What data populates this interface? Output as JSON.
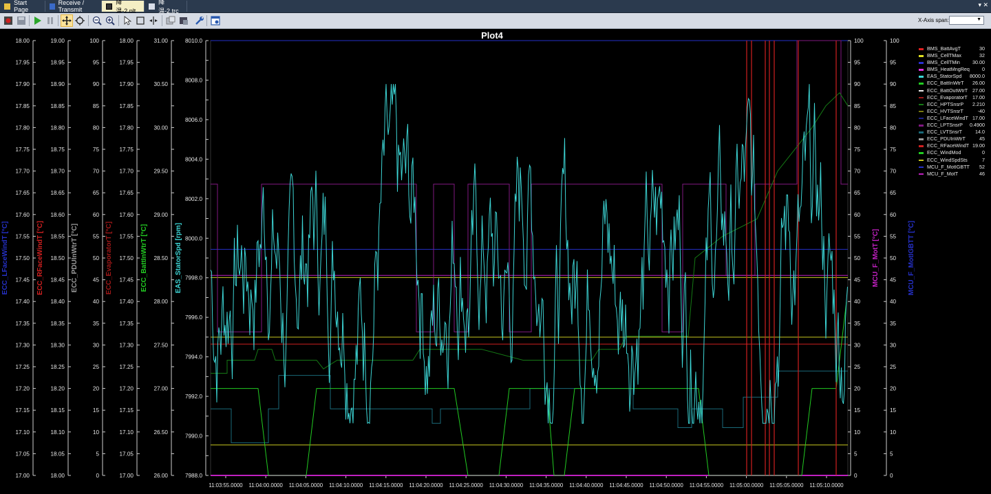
{
  "tabs": [
    {
      "label": "Start Page",
      "icon": "start-page-icon",
      "active": false
    },
    {
      "label": "Receive / Transmit",
      "icon": "receive-transmit-icon",
      "active": false
    },
    {
      "label": "降温-2.plt",
      "icon": "plot-file-icon",
      "active": true
    },
    {
      "label": "降温-2.trc",
      "icon": "trace-file-icon",
      "active": false
    }
  ],
  "toolbar": {
    "xspan_label": "X-Axis span:",
    "xspan_value": "",
    "buttons": [
      "record-icon",
      "save-icon",
      "play-icon",
      "pause-icon",
      "pan-icon",
      "zoom-fit-icon",
      "zoom-out-icon",
      "zoom-in-icon",
      "select-icon",
      "zoom-box-icon",
      "cursor-icon",
      "export-icon",
      "export-image-icon",
      "settings-icon",
      "layout-icon"
    ]
  },
  "colors": {
    "tabbar": "#2b3a4e",
    "toolbar": "#d6dbe4",
    "plot_bg": "#000000",
    "grid": "#1a1a1a",
    "stator": "#3dd6d6"
  },
  "plot": {
    "title": "Plot4",
    "left_axes": [
      {
        "name": "ECC_LFaceWindT [°C]",
        "color": "#2530c8",
        "ticks": [
          "18.00",
          "17.95",
          "17.90",
          "17.85",
          "17.80",
          "17.75",
          "17.70",
          "17.65",
          "17.60",
          "17.55",
          "17.50",
          "17.45",
          "17.40",
          "17.35",
          "17.30",
          "17.25",
          "17.20",
          "17.15",
          "17.10",
          "17.05",
          "17.00"
        ]
      },
      {
        "name": "ECC_RFaceWindT [°C]",
        "color": "#d02020",
        "ticks": [
          "19.00",
          "18.95",
          "18.90",
          "18.85",
          "18.80",
          "18.75",
          "18.70",
          "18.65",
          "18.60",
          "18.55",
          "18.50",
          "18.45",
          "18.40",
          "18.35",
          "18.30",
          "18.25",
          "18.20",
          "18.15",
          "18.10",
          "18.05",
          "18.00"
        ]
      },
      {
        "name": "ECC_PDUInWtrT [°C]",
        "color": "#9a9a9a",
        "ticks": [
          "100",
          "95",
          "90",
          "85",
          "80",
          "75",
          "70",
          "65",
          "60",
          "55",
          "50",
          "45",
          "40",
          "35",
          "30",
          "25",
          "20",
          "15",
          "10",
          "5",
          "0"
        ]
      },
      {
        "name": "ECC_EvaporatorT [°C]",
        "color": "#a01818",
        "ticks": [
          "18.00",
          "17.95",
          "17.90",
          "17.85",
          "17.80",
          "17.75",
          "17.70",
          "17.65",
          "17.60",
          "17.55",
          "17.50",
          "17.45",
          "17.40",
          "17.35",
          "17.30",
          "17.25",
          "17.20",
          "17.15",
          "17.10",
          "17.05",
          "17.00"
        ]
      },
      {
        "name": "ECC_BattInWtrT [°C]",
        "color": "#22cc22",
        "ticks": [
          "31.00",
          "",
          "30.50",
          "",
          "30.00",
          "",
          "29.50",
          "",
          "29.00",
          "",
          "28.50",
          "",
          "28.00",
          "",
          "27.50",
          "",
          "27.00",
          "",
          "26.50",
          "",
          "26.00"
        ]
      },
      {
        "name": "EAS_StatorSpd [rpm]",
        "color": "#3dd6d6",
        "ticks": [
          "8010.0",
          "",
          "8008.0",
          "",
          "8006.0",
          "",
          "8004.0",
          "",
          "8002.0",
          "",
          "8000.0",
          "",
          "7998.0",
          "",
          "7996.0",
          "",
          "7994.0",
          "",
          "7992.0",
          "",
          "7990.0",
          "",
          "7988.0"
        ]
      }
    ],
    "right_axes": [
      {
        "name": "MCU_F_MotT [°C]",
        "color": "#c020c0",
        "ticks": [
          "100",
          "95",
          "90",
          "85",
          "80",
          "75",
          "70",
          "65",
          "60",
          "55",
          "50",
          "45",
          "40",
          "35",
          "30",
          "25",
          "20",
          "15",
          "10",
          "5",
          "0"
        ]
      },
      {
        "name": "MCU_F_MotIGBTT [°C]",
        "color": "#2530c8",
        "ticks": [
          "100",
          "95",
          "90",
          "85",
          "80",
          "75",
          "70",
          "65",
          "60",
          "55",
          "50",
          "45",
          "40",
          "35",
          "30",
          "25",
          "20",
          "15",
          "10",
          "5",
          "0"
        ]
      }
    ],
    "x_ticks": [
      "11:03:55.0000",
      "11:04:00.0000",
      "11:04:05.0000",
      "11:04:10.0000",
      "11:04:15.0000",
      "11:04:20.0000",
      "11:04:25.0000",
      "11:04:30.0000",
      "11:04:35.0000",
      "11:04:40.0000",
      "11:04:45.0000",
      "11:04:50.0000",
      "11:04:55.0000",
      "11:05:00.0000",
      "11:05:05.0000",
      "11:05:10.0000"
    ],
    "legend": [
      {
        "name": "BMS_BattAvgT",
        "value": "30",
        "color": "#e02020"
      },
      {
        "name": "BMS_CellTMax",
        "value": "32",
        "color": "#e0e020"
      },
      {
        "name": "BMS_CellTMin",
        "value": "30.00",
        "color": "#2a30d0"
      },
      {
        "name": "BMS_HeatMngReq",
        "value": "0",
        "color": "#e030e0"
      },
      {
        "name": "EAS_StatorSpd",
        "value": "8000.0",
        "color": "#3dd6d6"
      },
      {
        "name": "ECC_BattInWtrT",
        "value": "26.00",
        "color": "#22cc22"
      },
      {
        "name": "ECC_BattOutWtrT",
        "value": "27.00",
        "color": "#f0f0f0"
      },
      {
        "name": "ECC_EvaporatorT",
        "value": "17.00",
        "color": "#a01818"
      },
      {
        "name": "ECC_HPTSnsrP",
        "value": "2.210",
        "color": "#157a15"
      },
      {
        "name": "ECC_HVTSnsrT",
        "value": "-40",
        "color": "#7a7a10"
      },
      {
        "name": "ECC_LFaceWindT",
        "value": "17.00",
        "color": "#1c2288"
      },
      {
        "name": "ECC_LPTSnsrP",
        "value": "0.4900",
        "color": "#801880"
      },
      {
        "name": "ECC_LVTSnsrT",
        "value": "14.0",
        "color": "#1a6a7a"
      },
      {
        "name": "ECC_PDUInWtrT",
        "value": "45",
        "color": "#9a9a9a"
      },
      {
        "name": "ECC_RFaceWindT",
        "value": "19.00",
        "color": "#d02020"
      },
      {
        "name": "ECC_WindMod",
        "value": "0",
        "color": "#22cc22"
      },
      {
        "name": "ECC_WindSpdSts",
        "value": "7",
        "color": "#c8c820"
      },
      {
        "name": "MCU_F_MotIGBTT",
        "value": "52",
        "color": "#2530c8"
      },
      {
        "name": "MCU_F_MotT",
        "value": "46",
        "color": "#c020c0"
      }
    ]
  }
}
